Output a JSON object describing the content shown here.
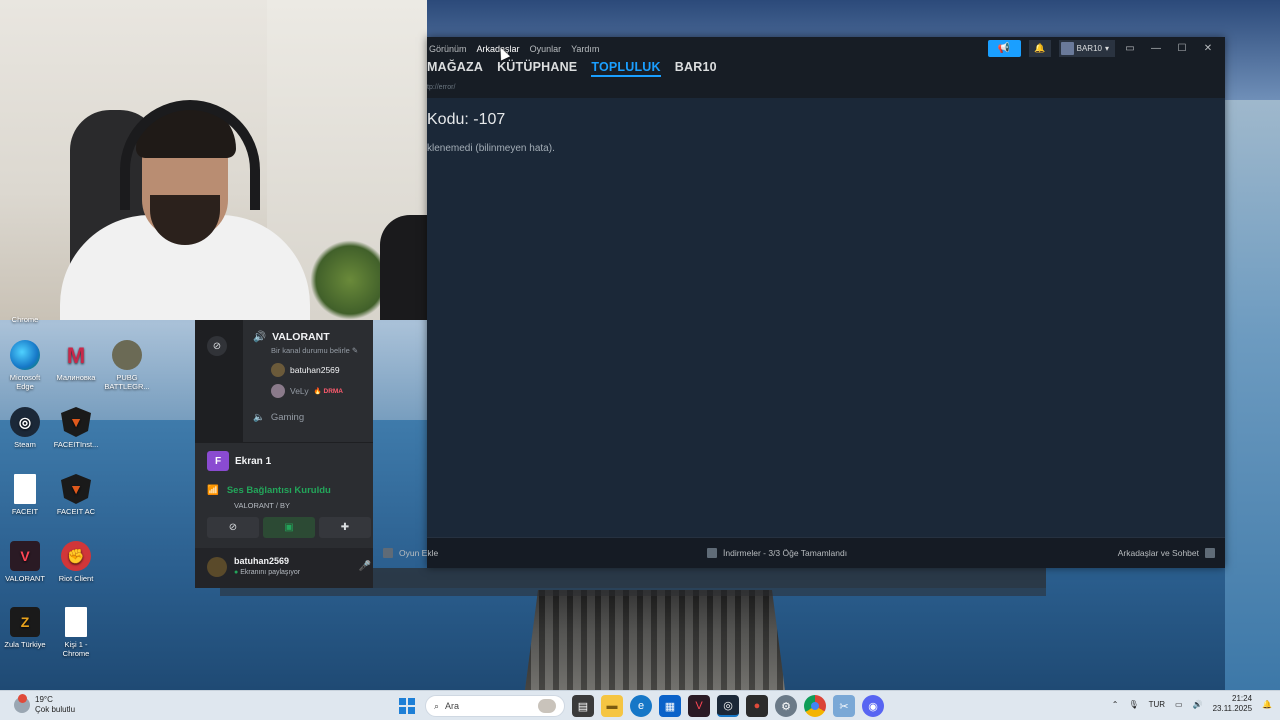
{
  "steam": {
    "menu": [
      "Görünüm",
      "Arkadaşlar",
      "Oyunlar",
      "Yardım"
    ],
    "menu_active_index": 1,
    "nav": [
      "MAĞAZA",
      "KÜTÜPHANE",
      "TOPLULUK",
      "BAR10"
    ],
    "nav_selected": "TOPLULUK",
    "url": "tp://error/",
    "account_name": "BAR10",
    "error_title": "Kodu: -107",
    "error_message": "klenemedi (bilinmeyen hata).",
    "bottom": {
      "add_game": "Oyun Ekle",
      "downloads": "İndirmeler - 3/3 Öğe Tamamlandı",
      "friends_chat": "Arkadaşlar ve Sohbet"
    }
  },
  "discord": {
    "channel": "VALORANT",
    "channel_status": "Bir kanal durumu belirle",
    "users": [
      {
        "name": "batuhan2569",
        "badge": ""
      },
      {
        "name": "VeLy",
        "badge": "DRMA"
      }
    ],
    "other_channel": "Gaming",
    "screen_label": "Ekran 1",
    "screen_icon_letter": "F",
    "voice_status": "Ses Bağlantısı Kuruldu",
    "voice_sub": "VALORANT / BY",
    "me": {
      "name": "batuhan2569",
      "status": "Ekranını paylaşıyor"
    }
  },
  "desktop_icons": [
    {
      "label": "Chrome",
      "color": "#2b6cb0"
    },
    {
      "label": "Microsoft Edge",
      "color": "#1677c7"
    },
    {
      "label": "Малиновка",
      "color": "#c8284a"
    },
    {
      "label": "PUBG BATTLEGR...",
      "color": "#8a6a3a"
    },
    {
      "label": "Steam",
      "color": "#1b2838"
    },
    {
      "label": "FACEITInst...",
      "color": "#e0591c"
    },
    {
      "label": "FACEIT",
      "color": "#ffffff"
    },
    {
      "label": "FACEIT AC",
      "color": "#e0591c"
    },
    {
      "label": "VALORANT",
      "color": "#ff4655"
    },
    {
      "label": "Riot Client",
      "color": "#d13639"
    },
    {
      "label": "Zula Türkiye",
      "color": "#e8a21c"
    },
    {
      "label": "Kişi 1 - Chrome",
      "color": "#ffffff"
    }
  ],
  "taskbar": {
    "weather_temp": "19°C",
    "weather_desc": "Çok bulutlu",
    "search_placeholder": "Ara",
    "language": "TUR",
    "time": "21:24",
    "date": "23.11.2025"
  }
}
